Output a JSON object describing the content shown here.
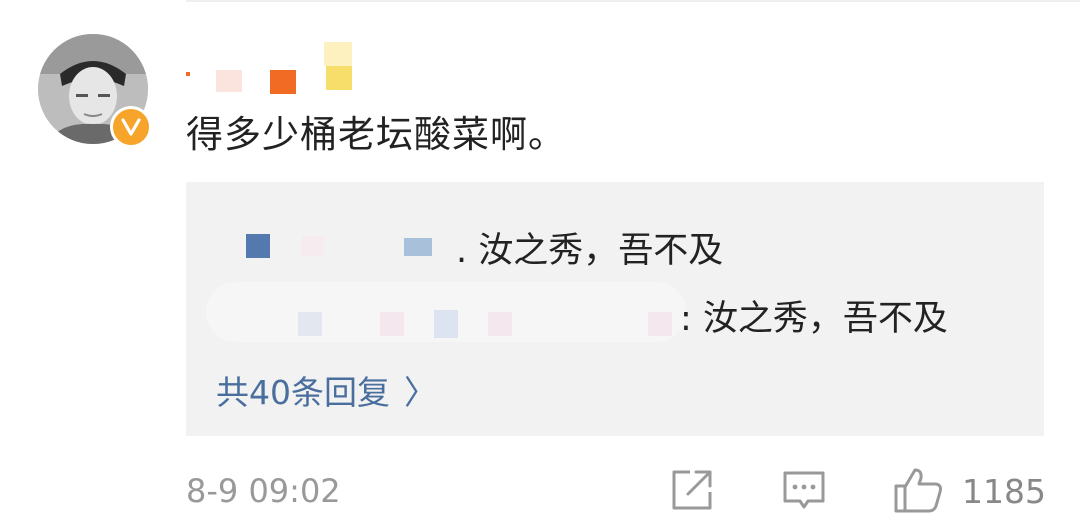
{
  "comment": {
    "text": "得多少桶老坛酸菜啊。",
    "time": "8-9 09:02",
    "likes": "1185"
  },
  "replies": [
    {
      "text": ". 汝之秀，吾不及"
    },
    {
      "text": ": 汝之秀，吾不及"
    }
  ],
  "more_replies_label": "共40条回复",
  "more_replies_chevron": "〉",
  "colors": {
    "badge": "#f7a42a",
    "link": "#4a6f9e",
    "reply_bg": "#f2f2f2",
    "muted": "#999999"
  },
  "icons": [
    "verified-badge-icon",
    "share-icon",
    "comment-icon",
    "like-icon",
    "chevron-right-icon"
  ]
}
